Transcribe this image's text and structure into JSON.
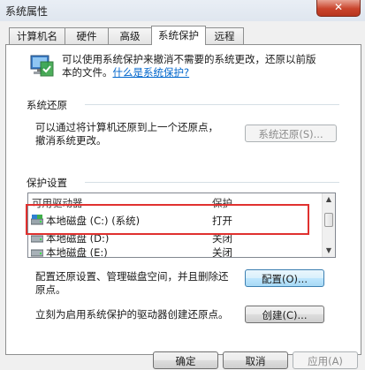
{
  "window": {
    "title": "系统属性",
    "close_label": "✕"
  },
  "tabs": [
    {
      "label": "计算机名"
    },
    {
      "label": "硬件"
    },
    {
      "label": "高级"
    },
    {
      "label": "系统保护"
    },
    {
      "label": "远程"
    }
  ],
  "intro": {
    "text_line1": "可以使用系统保护来撤消不需要的系统更改，还原以前版",
    "text_line2_prefix": "本的文件。",
    "link": "什么是系统保护?"
  },
  "restore": {
    "group_title": "系统还原",
    "description_line1": "可以通过将计算机还原到上一个还原点，",
    "description_line2": "撤消系统更改。",
    "button": "系统还原(S)..."
  },
  "protection": {
    "group_title": "保护设置",
    "columns": [
      "可用驱动器",
      "保护"
    ],
    "drives": [
      {
        "name": "本地磁盘 (C:) (系统)",
        "protection": "打开",
        "icon": "system-drive-icon"
      },
      {
        "name": "本地磁盘 (D:)",
        "protection": "关闭",
        "icon": "drive-icon"
      },
      {
        "name": "本地磁盘 (E:)",
        "protection": "关闭",
        "icon": "drive-icon"
      }
    ],
    "configure_text_line1": "配置还原设置、管理磁盘空间，并且删除还",
    "configure_text_line2": "原点。",
    "configure_button": "配置(O)...",
    "create_text": "立刻为启用系统保护的驱动器创建还原点。",
    "create_button": "创建(C)..."
  },
  "footer": {
    "ok": "确定",
    "cancel": "取消",
    "apply": "应用(A)"
  },
  "colors": {
    "highlight": "#e0312f",
    "link": "#0066cc"
  }
}
